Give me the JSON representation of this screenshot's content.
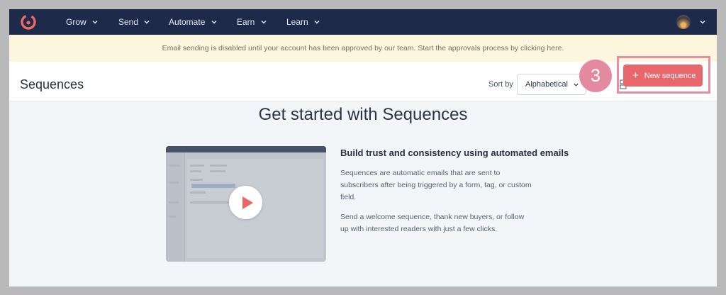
{
  "nav": {
    "items": [
      {
        "label": "Grow"
      },
      {
        "label": "Send"
      },
      {
        "label": "Automate"
      },
      {
        "label": "Earn"
      },
      {
        "label": "Learn"
      }
    ]
  },
  "banner": {
    "text": "Email sending is disabled until your account has been approved by our team. Start the approvals process by clicking here."
  },
  "header": {
    "title": "Sequences",
    "sort_label": "Sort by",
    "sort_value": "Alphabetical",
    "new_button_label": "New sequence"
  },
  "annotation": {
    "step_number": "3"
  },
  "main": {
    "title": "Get started with Sequences",
    "subtitle": "Build trust and consistency using automated emails",
    "paragraph1": "Sequences are automatic emails that are sent to subscribers after being triggered by a form, tag, or custom field.",
    "paragraph2": "Send a welcome sequence, thank new buyers, or follow up with interested readers with just a few clicks."
  },
  "colors": {
    "nav_bg": "#1e2a4a",
    "accent": "#e8676a",
    "banner_bg": "#fbf6dd",
    "highlight": "#e98ca4"
  },
  "icons": {
    "logo": "convertkit-logo-icon",
    "chevron": "chevron-down-icon",
    "play": "play-icon",
    "view": "grid-view-icon",
    "plus": "plus-icon"
  }
}
